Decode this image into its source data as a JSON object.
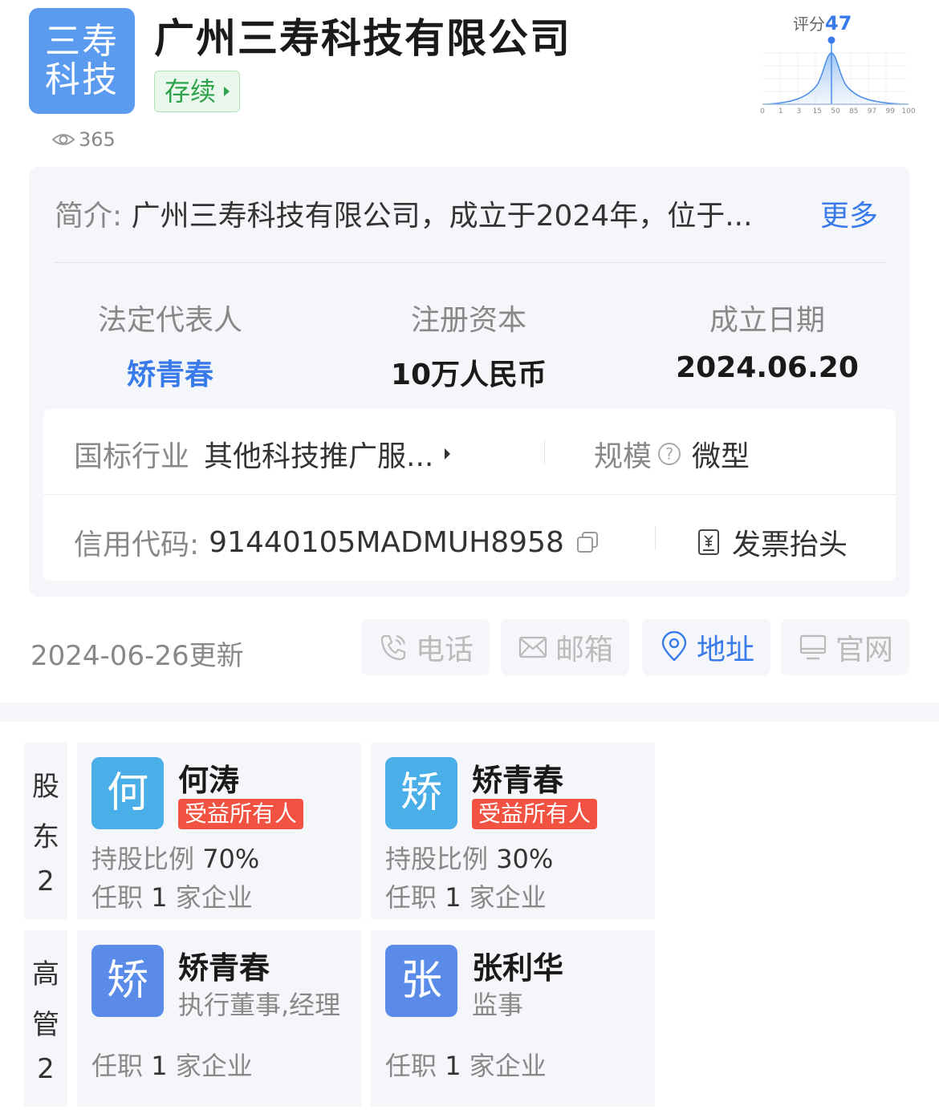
{
  "company": {
    "logo_line1": "三寿",
    "logo_line2": "科技",
    "name": "广州三寿科技有限公司",
    "status": "存续",
    "views": "365"
  },
  "score": {
    "label": "评分",
    "value": "47",
    "axis_ticks": [
      "0",
      "1",
      "3",
      "15",
      "50",
      "85",
      "97",
      "99",
      "100"
    ]
  },
  "intro": {
    "label": "简介:",
    "text": "广州三寿科技有限公司，成立于2024年，位于...",
    "more": "更多"
  },
  "key_facts": [
    {
      "label": "法定代表人",
      "value": "矫青春"
    },
    {
      "label": "注册资本",
      "value": "10万人民币"
    },
    {
      "label": "成立日期",
      "value": "2024.06.20"
    }
  ],
  "industry": {
    "label": "国标行业",
    "value": "其他科技推广服..."
  },
  "scale": {
    "label": "规模",
    "value": "微型"
  },
  "credit": {
    "label": "信用代码:",
    "value": "91440105MADMUH8958"
  },
  "invoice": {
    "label": "发票抬头"
  },
  "updated": "2024-06-26更新",
  "actions": [
    {
      "label": "电话",
      "icon": "phone-icon"
    },
    {
      "label": "邮箱",
      "icon": "mail-icon"
    },
    {
      "label": "地址",
      "icon": "location-icon"
    },
    {
      "label": "官网",
      "icon": "monitor-icon"
    }
  ],
  "shareholders": {
    "side_c1": "股",
    "side_c2": "东",
    "count": "2",
    "items": [
      {
        "avatar": "何",
        "name": "何涛",
        "tag": "受益所有人",
        "ratio_label": "持股比例",
        "ratio": "70%",
        "jobs_prefix": "任职",
        "jobs_count": "1",
        "jobs_suffix": "家企业"
      },
      {
        "avatar": "矫",
        "name": "矫青春",
        "tag": "受益所有人",
        "ratio_label": "持股比例",
        "ratio": "30%",
        "jobs_prefix": "任职",
        "jobs_count": "1",
        "jobs_suffix": "家企业"
      }
    ]
  },
  "executives": {
    "side_c1": "高",
    "side_c2": "管",
    "count": "2",
    "items": [
      {
        "avatar": "矫",
        "name": "矫青春",
        "role": "执行董事,经理",
        "jobs_prefix": "任职",
        "jobs_count": "1",
        "jobs_suffix": "家企业"
      },
      {
        "avatar": "张",
        "name": "张利华",
        "role": "监事",
        "jobs_prefix": "任职",
        "jobs_count": "1",
        "jobs_suffix": "家企业"
      }
    ]
  },
  "colors": {
    "brand_blue": "#3a7bec",
    "status_green": "#2fa34b",
    "tag_red": "#f25241",
    "logo_blue": "#5b9bef"
  }
}
